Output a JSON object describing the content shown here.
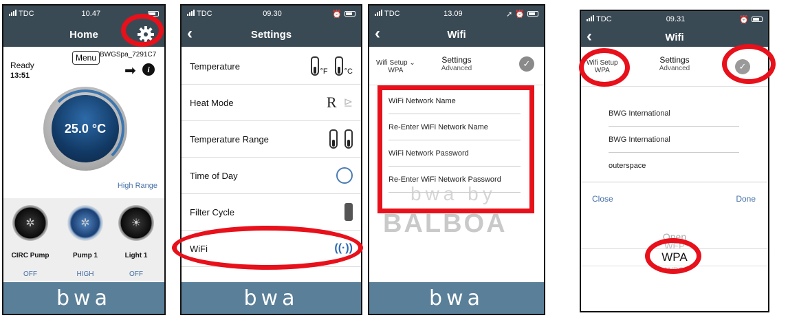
{
  "status": {
    "carrier": "TDC",
    "s1_time": "10.47",
    "s2_time": "09.30",
    "s3_time": "13.09",
    "s4_time": "09.31"
  },
  "home": {
    "title": "Home",
    "ready": "Ready",
    "ready_time": "13:51",
    "menu": "Menu",
    "spa_name": "BWGSpa_7291C7",
    "temperature": "25.0 °C",
    "high_range": "High Range",
    "equipment": [
      {
        "label": "CIRC Pump",
        "state": "OFF"
      },
      {
        "label": "Pump 1",
        "state": "HIGH"
      },
      {
        "label": "Light 1",
        "state": "OFF"
      }
    ]
  },
  "settings": {
    "title": "Settings",
    "rows": [
      {
        "label": "Temperature"
      },
      {
        "label": "Heat Mode"
      },
      {
        "label": "Temperature Range"
      },
      {
        "label": "Time of Day"
      },
      {
        "label": "Filter Cycle"
      },
      {
        "label": "WiFi"
      }
    ],
    "unit_f": "°F",
    "unit_c": "°C",
    "heat_r": "R"
  },
  "wifi": {
    "title": "Wifi",
    "setup_label": "Wifi Setup",
    "setup_value": "WPA",
    "settings_label": "Settings",
    "advanced_label": "Advanced",
    "fields": [
      "WiFi Network Name",
      "Re-Enter WiFi Network Name",
      "WiFi Network Password",
      "Re-Enter WiFi Network Password"
    ],
    "brand_ghost": "BALBOA",
    "bwa_by": "bwa by"
  },
  "wifi_entry": {
    "title": "Wifi",
    "setup_label": "Wifi Setup",
    "setup_value": "WPA",
    "settings_label": "Settings",
    "advanced_label": "Advanced",
    "values": [
      "BWG International",
      "BWG International",
      "outerspace"
    ],
    "close": "Close",
    "done": "Done",
    "picker": [
      "Open",
      "WEP",
      "WPA",
      "WPS"
    ]
  },
  "footer_logo": "bwa"
}
